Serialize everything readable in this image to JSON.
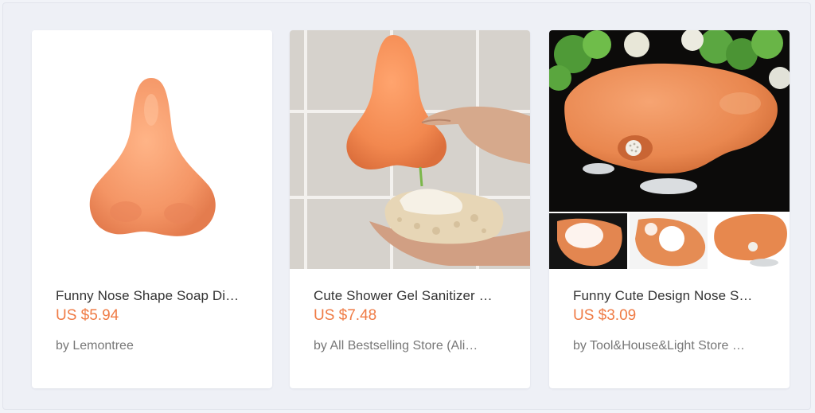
{
  "products": [
    {
      "title": "Funny Nose Shape Soap Di…",
      "price": "US $5.94",
      "store": "by Lemontree",
      "image": "orange-nose-soap-dish-icon"
    },
    {
      "title": "Cute Shower Gel Sanitizer …",
      "price": "US $7.48",
      "store": "by All Bestselling Store (Ali…",
      "image": "nose-shower-gel-dispenser-icon"
    },
    {
      "title": "Funny Cute Design Nose S…",
      "price": "US $3.09",
      "store": "by Tool&House&Light Store …",
      "image": "nose-soap-holder-collage-icon"
    }
  ],
  "colors": {
    "price": "#ef7b45",
    "nose": "#f2965f",
    "background": "#eef0f6"
  }
}
